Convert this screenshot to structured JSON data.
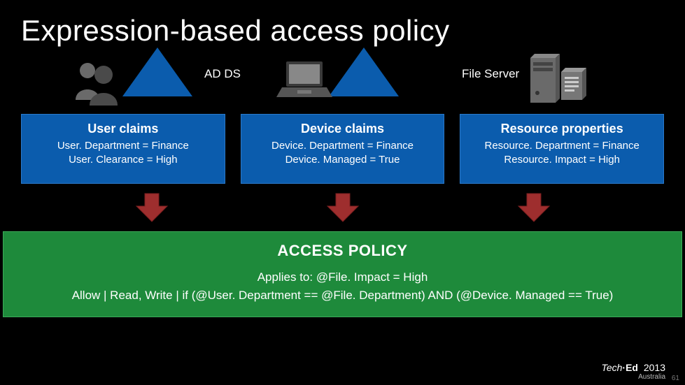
{
  "title": "Expression-based access policy",
  "labels": {
    "adds": "AD DS",
    "file_server": "File Server"
  },
  "boxes": {
    "user": {
      "header": "User claims",
      "line1": "User. Department = Finance",
      "line2": "User. Clearance = High"
    },
    "device": {
      "header": "Device claims",
      "line1": "Device. Department = Finance",
      "line2": "Device. Managed = True"
    },
    "resource": {
      "header": "Resource properties",
      "line1": "Resource. Department = Finance",
      "line2": "Resource. Impact = High"
    }
  },
  "policy": {
    "header": "ACCESS POLICY",
    "applies": "Applies to: @File. Impact = High",
    "allow": "Allow | Read, Write | if (@User. Department == @File. Department) AND (@Device. Managed == True)"
  },
  "brand": {
    "t1": "Tech",
    "t2": "·",
    "t3": "Ed",
    "year": "2013",
    "sub": "Australia"
  },
  "page_num": "61"
}
